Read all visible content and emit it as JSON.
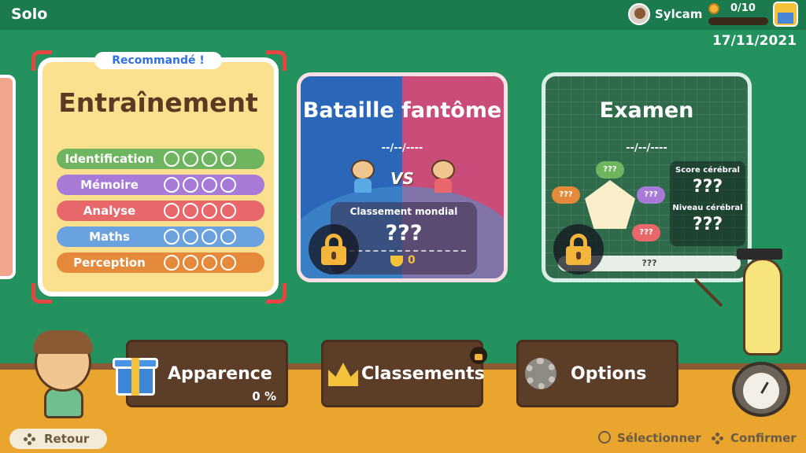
{
  "header": {
    "title": "Solo",
    "username": "Sylcam",
    "coins": "0/10",
    "date": "17/11/2021"
  },
  "training": {
    "recommended": "Recommandé !",
    "title": "Entraînement",
    "skills": [
      {
        "label": "Identification",
        "color": "#6fb55f"
      },
      {
        "label": "Mémoire",
        "color": "#a67ad6"
      },
      {
        "label": "Analyse",
        "color": "#e8676a"
      },
      {
        "label": "Maths",
        "color": "#6aa2e0"
      },
      {
        "label": "Perception",
        "color": "#e58a3a"
      }
    ]
  },
  "ghost": {
    "title": "Bataille fantôme",
    "date": "--/--/----",
    "vs": "VS",
    "rank_label": "Classement mondial",
    "rank_value": "???",
    "trophies": "0"
  },
  "exam": {
    "title": "Examen",
    "date": "--/--/----",
    "clouds": [
      "???",
      "???",
      "???",
      "???"
    ],
    "score_label": "Score cérébral",
    "score_value": "???",
    "level_label": "Niveau cérébral",
    "level_value": "???",
    "bar_text": "???"
  },
  "menu": {
    "appearance_label": "Apparence",
    "appearance_progress": "0 %",
    "rankings_label": "Classements",
    "options_label": "Options"
  },
  "footer": {
    "back": "Retour",
    "select": "Sélectionner",
    "confirm": "Confirmer"
  }
}
